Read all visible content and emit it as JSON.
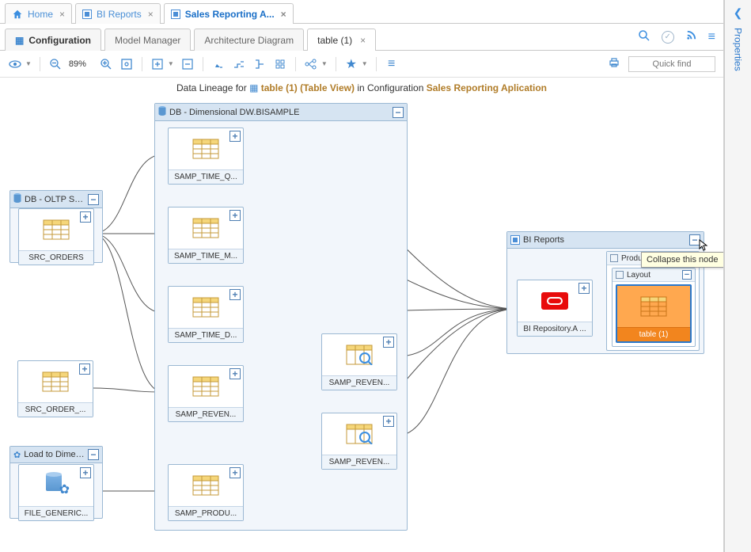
{
  "topTabs": [
    {
      "label": "Home",
      "icon": "home-icon",
      "active": false
    },
    {
      "label": "BI Reports",
      "icon": "app-icon",
      "active": false
    },
    {
      "label": "Sales Reporting A...",
      "icon": "app-icon",
      "active": true
    }
  ],
  "subTabs": {
    "left": [
      {
        "label": "Configuration",
        "icon": "grid-icon",
        "strong": true,
        "closable": false
      },
      {
        "label": "Model Manager",
        "closable": false
      },
      {
        "label": "Architecture Diagram",
        "closable": false
      },
      {
        "label": "table (1)",
        "closable": true,
        "active": true
      }
    ]
  },
  "toolbar": {
    "zoom": "89%",
    "quickfind_placeholder": "Quick find"
  },
  "lineageTitle": {
    "prefix": "Data Lineage for",
    "object": "table (1) (Table View)",
    "in": "in Configuration",
    "config": "Sales Reporting Aplication"
  },
  "propertiesPanel": {
    "label": "Properties"
  },
  "tooltip": "Collapse this node",
  "groups": {
    "oltp": {
      "title": "DB - OLTP So..."
    },
    "dim": {
      "title": "DB - Dimensional DW.BISAMPLE"
    },
    "etl": {
      "title": "Load to Dimen..."
    },
    "bi": {
      "title": "BI Reports"
    },
    "products": {
      "title": "Products Report"
    },
    "layout": {
      "title": "Layout"
    }
  },
  "nodes": {
    "src_orders": "SRC_ORDERS",
    "src_order": "SRC_ORDER_...",
    "file_generic": "FILE_GENERIC...",
    "samp_time_q": "SAMP_TIME_Q...",
    "samp_time_m": "SAMP_TIME_M...",
    "samp_time_d": "SAMP_TIME_D...",
    "samp_reven1": "SAMP_REVEN...",
    "samp_produ": "SAMP_PRODU...",
    "samp_reven_v1": "SAMP_REVEN...",
    "samp_reven_v2": "SAMP_REVEN...",
    "bi_repo": "BI Repository.A ...",
    "table1": "table (1)"
  }
}
